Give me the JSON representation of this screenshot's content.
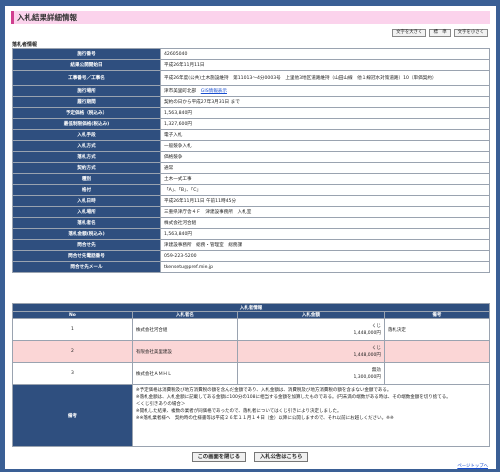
{
  "page": {
    "title": "入札結果詳細情報",
    "section_label": "落札者情報"
  },
  "font_buttons": {
    "large": "文字を大きく",
    "standard": "標　準",
    "small": "文字を小さく"
  },
  "info_rows": [
    {
      "label": "施行番号",
      "value": "42605040"
    },
    {
      "label": "結果公開開始日",
      "value": "平成26年11月11日"
    },
    {
      "label": "工事番号／工事名",
      "value": "平成26年度(公共)土木施設維持　第11013～4分0003号　上里他3地区道路維持（山田山線　他１線冠水対策道路）10（単価契約）"
    },
    {
      "label": "施行場所",
      "value": "津市美里町北部",
      "link": "GIS情報表示"
    },
    {
      "label": "履行期間",
      "value": "契約の日から平成27年3月31日 まで"
    },
    {
      "label": "予定価格（税込み）",
      "value": "1,563,840円"
    },
    {
      "label": "最低制限価格(税込み)",
      "value": "1,327,600円"
    },
    {
      "label": "入札手段",
      "value": "電子入札"
    },
    {
      "label": "入札方式",
      "value": "一般競争入札"
    },
    {
      "label": "落札方式",
      "value": "価格競争"
    },
    {
      "label": "契約方式",
      "value": "通常"
    },
    {
      "label": "種別",
      "value": "土木一式工事"
    },
    {
      "label": "格付",
      "value": "「A」、「B」、「C」"
    },
    {
      "label": "入札日時",
      "value": "平成26年11月11日 午前11時45分"
    },
    {
      "label": "入札場所",
      "value": "三重県津庁舎４Ｆ　津建設事務所　入札室"
    },
    {
      "label": "落札者名",
      "value": "株式会社河合組"
    },
    {
      "label": "落札金額(税込み)",
      "value": "1,563,840円"
    },
    {
      "label": "問合せ先",
      "value": "津建設事務所　総務・管理室　総務課"
    },
    {
      "label": "問合せ先電話番号",
      "value": "059-223-5200"
    },
    {
      "label": "問合せ先メール",
      "value": "tkensetu@pref.mie.jp"
    }
  ],
  "results": {
    "caption": "入札者情報",
    "headers": {
      "no": "No",
      "name": "入札者名",
      "amount": "入札金額",
      "note": "備考"
    },
    "rows": [
      {
        "no": "1",
        "name": "株式会社河合組",
        "amount_line1": "くじ",
        "amount_line2": "1,448,000円",
        "note": "落札決定"
      },
      {
        "no": "2",
        "name": "有限会社美里建設",
        "amount_line1": "くじ",
        "amount_line2": "1,448,000円",
        "note": ""
      },
      {
        "no": "3",
        "name": "株式会社ＡＭＨＬ",
        "amount_line1": "無効",
        "amount_line2": "1,300,000円",
        "note": ""
      }
    ],
    "remarks_label": "備考",
    "remarks": [
      "※予定価格は消費税及び地方消費税の額を含んだ金額であり、入札金額は、消費税及び地方消費税の額を含まない金額である。",
      "※落札金額は、入札金額に記載してある金額に100分の108に相当する金額を加算したものである。(円未満の端数がある時は、その端数金額を切り捨てる。",
      "＜くじ引きありの場合＞",
      "※開札した結果、複数の業者が同価格であったので、落札者についてはくじ引きにより決定しました。",
      "※※落札業者様へ　契約時の仕様書等は平成２６年１１月１４日（金）以降に公開しますので、それ以前にお越しください。※※"
    ]
  },
  "bottom": {
    "close_label": "この画面を閉じる",
    "notice_label": "入札公告はこちら",
    "top_link": "ページトップへ"
  }
}
